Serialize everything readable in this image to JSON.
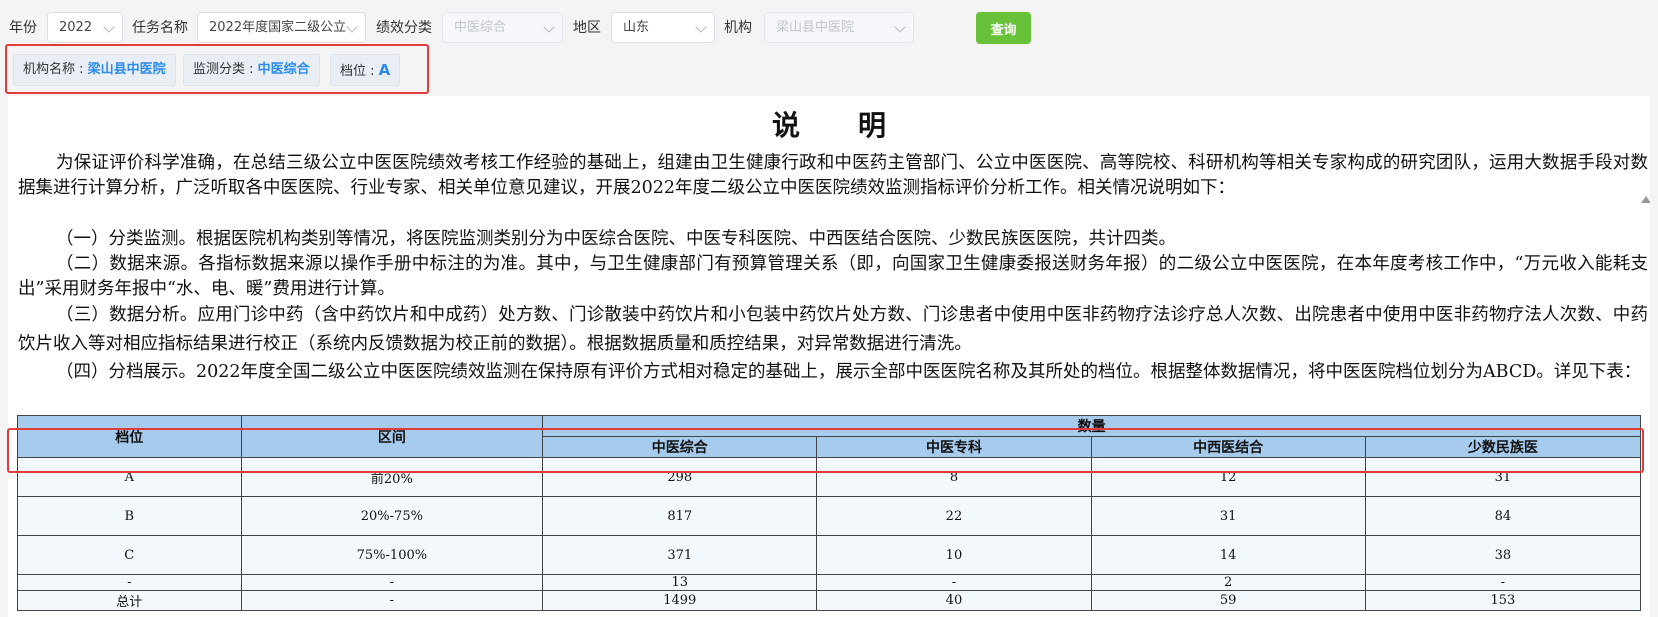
{
  "filters": {
    "year_label": "年份",
    "year_value": "2022",
    "task_label": "任务名称",
    "task_value": "2022年度国家二级公立",
    "perf_label": "绩效分类",
    "perf_value": "中医综合",
    "region_label": "地区",
    "region_value": "山东",
    "org_label": "机构",
    "org_value": "梁山县中医院",
    "query_button": "查询"
  },
  "tags": {
    "org_name_label": "机构名称 : ",
    "org_name_value": "梁山县中医院",
    "monitor_label": "监测分类 : ",
    "monitor_value": "中医综合",
    "grade_label": "档位 : ",
    "grade_value": "A"
  },
  "document": {
    "title": "说明",
    "paragraphs": [
      "为保证评价科学准确，在总结三级公立中医医院绩效考核工作经验的基础上，组建由卫生健康行政和中医药主管部门、公立中医医院、高等院校、科研机构等相关专家构成的研究团队，运用大数据手段对数据集进行计算分析，广泛听取各中医医院、行业专家、相关单位意见建议，开展2022年度二级公立中医医院绩效监测指标评价分析工作。相关情况说明如下：",
      "（一）分类监测。根据医院机构类别等情况，将医院监测类别分为中医综合医院、中医专科医院、中西医结合医院、少数民族医医院，共计四类。",
      "（二）数据来源。各指标数据来源以操作手册中标注的为准。其中，与卫生健康部门有预算管理关系（即，向国家卫生健康委报送财务年报）的二级公立中医医院，在本年度考核工作中，“万元收入能耗支出”采用财务年报中“水、电、暖”费用进行计算。",
      "（三）数据分析。应用门诊中药（含中药饮片和中成药）处方数、门诊散装中药饮片和小包装中药饮片处方数、门诊患者中使用中医非药物疗法诊疗总人次数、出院患者中使用中医非药物疗法人次数、中药饮片收入等对相应指标结果进行校正（系统内反馈数据为校正前的数据）。根据数据质量和质控结果，对异常数据进行清洗。",
      "（四）分档展示。2022年度全国二级公立中医医院绩效监测在保持原有评价方式相对稳定的基础上，展示全部中医医院名称及其所处的档位。根据整体数据情况，将中医医院档位划分为ABCD。详见下表："
    ]
  },
  "table": {
    "headers": {
      "grade": "档位",
      "range": "区间",
      "count": "数量",
      "sub": [
        "中医综合",
        "中医专科",
        "中西医结合",
        "少数民族医"
      ]
    },
    "rows": [
      [
        "A",
        "前20%",
        "298",
        "8",
        "12",
        "31"
      ],
      [
        "B",
        "20%-75%",
        "817",
        "22",
        "31",
        "84"
      ],
      [
        "C",
        "75%-100%",
        "371",
        "10",
        "14",
        "38"
      ],
      [
        "-",
        "-",
        "13",
        "-",
        "2",
        "-"
      ],
      [
        "总计",
        "-",
        "1499",
        "40",
        "59",
        "153"
      ]
    ]
  }
}
